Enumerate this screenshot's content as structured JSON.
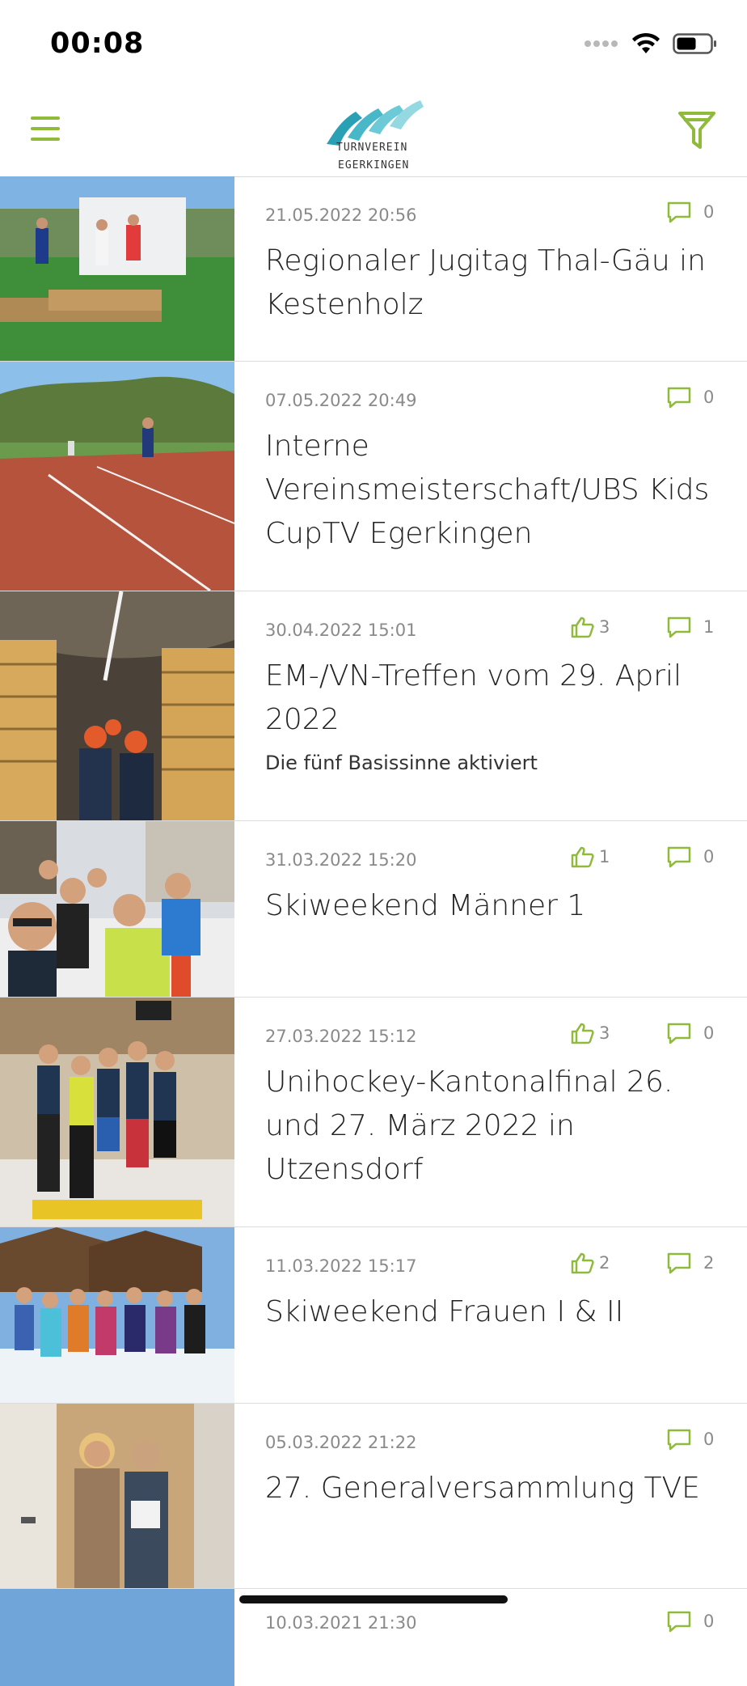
{
  "status_bar": {
    "time": "00:08"
  },
  "app": {
    "logo_line1": "TURNVEREIN",
    "logo_line2": "EGERKINGEN",
    "accent_color": "#8fba3a"
  },
  "icons": {
    "menu": "hamburger-menu-icon",
    "filter": "funnel-filter-icon",
    "like": "thumbs-up-icon",
    "comment": "speech-bubble-icon"
  },
  "posts": [
    {
      "date": "21.05.2022 20:56",
      "title": "Regionaler Jugitag Thal-Gäu in Kestenholz",
      "subtitle": "",
      "likes": "",
      "comments": "0"
    },
    {
      "date": "07.05.2022 20:49",
      "title": "Interne Vereinsmeisterschaft/UBS Kids CupTV Egerkingen",
      "subtitle": "",
      "likes": "",
      "comments": "0"
    },
    {
      "date": "30.04.2022 15:01",
      "title": "EM-/VN-Treffen vom 29. April 2022",
      "subtitle": "Die fünf Basissinne aktiviert",
      "likes": "3",
      "comments": "1"
    },
    {
      "date": "31.03.2022 15:20",
      "title": "Skiweekend Männer 1",
      "subtitle": "",
      "likes": "1",
      "comments": "0"
    },
    {
      "date": "27.03.2022 15:12",
      "title": "Unihockey-Kantonalfinal 26. und 27. März 2022 in Utzensdorf",
      "subtitle": "",
      "likes": "3",
      "comments": "0"
    },
    {
      "date": "11.03.2022 15:17",
      "title": "Skiweekend Frauen I & II",
      "subtitle": "",
      "likes": "2",
      "comments": "2"
    },
    {
      "date": "05.03.2022 21:22",
      "title": "27. Generalversammlung TVE",
      "subtitle": "",
      "likes": "",
      "comments": "0"
    },
    {
      "date": "10.03.2021 21:30",
      "title": "",
      "subtitle": "",
      "likes": "",
      "comments": "0"
    }
  ]
}
